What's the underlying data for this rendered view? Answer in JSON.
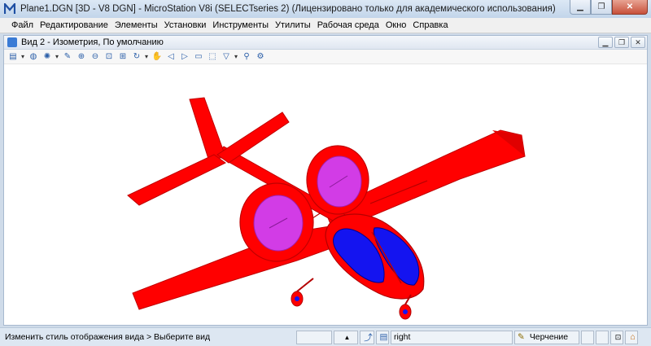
{
  "window": {
    "title": "Plane1.DGN [3D - V8 DGN] - MicroStation V8i (SELECTseries 2) (Лицензировано только для академического использования)",
    "icon": "microstation-logo-icon"
  },
  "menu": {
    "items": [
      "Файл",
      "Редактирование",
      "Элементы",
      "Установки",
      "Инструменты",
      "Утилиты",
      "Рабочая среда",
      "Окно",
      "Справка"
    ]
  },
  "view": {
    "title": "Вид 2 - Изометрия, По умолчанию"
  },
  "status": {
    "message": "Изменить стиль отображения вида > Выберите вид",
    "level": "right",
    "mode": "Черчение"
  },
  "colors": {
    "model_red": "#ff0000",
    "model_red_dark": "#b40000",
    "rotor_magenta": "#d23ce6",
    "canopy_blue": "#1414f0"
  }
}
